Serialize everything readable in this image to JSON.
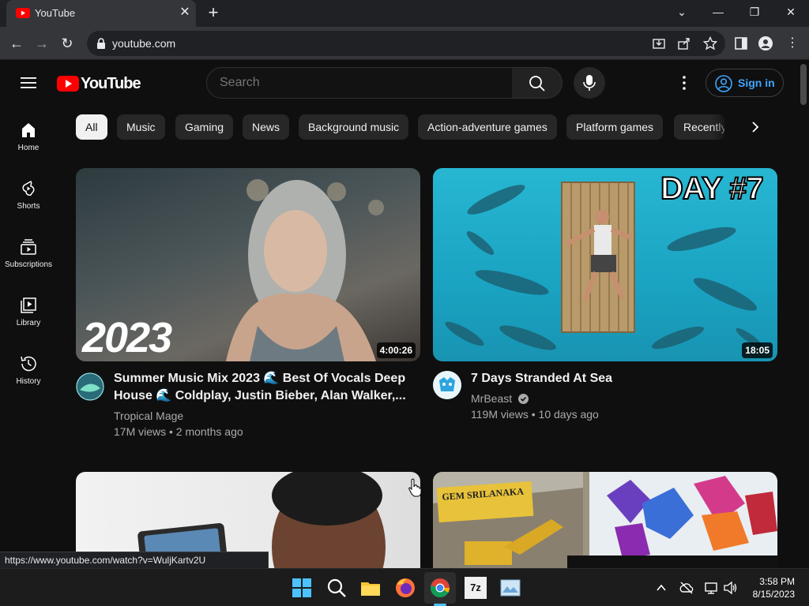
{
  "browser": {
    "tab_title": "YouTube",
    "url": "youtube.com",
    "status_url": "https://www.youtube.com/watch?v=WuljKartv2U"
  },
  "masthead": {
    "logo_text": "YouTube",
    "search_placeholder": "Search",
    "signin_label": "Sign in"
  },
  "sidebar": {
    "items": [
      {
        "label": "Home"
      },
      {
        "label": "Shorts"
      },
      {
        "label": "Subscriptions"
      },
      {
        "label": "Library"
      },
      {
        "label": "History"
      }
    ]
  },
  "chips": [
    "All",
    "Music",
    "Gaming",
    "News",
    "Background music",
    "Action-adventure games",
    "Platform games",
    "Recently"
  ],
  "videos": [
    {
      "thumb_text": "2023",
      "duration": "4:00:26",
      "title_line1": "Summer Music Mix 2023 🌊 Best Of Vocals Deep",
      "title_line2": "House 🌊 Coldplay, Justin Bieber, Alan Walker,...",
      "channel": "Tropical Mage",
      "stats": "17M views • 2 months ago"
    },
    {
      "thumb_text": "DAY #7",
      "duration": "18:05",
      "title_line1": "7 Days Stranded At Sea",
      "channel": "MrBeast",
      "stats": "119M views • 10 days ago"
    },
    {
      "thumb_text": ""
    },
    {
      "thumb_text": "GEM SRILANAKA"
    }
  ],
  "taskbar": {
    "time": "3:58 PM",
    "date": "8/15/2023"
  }
}
